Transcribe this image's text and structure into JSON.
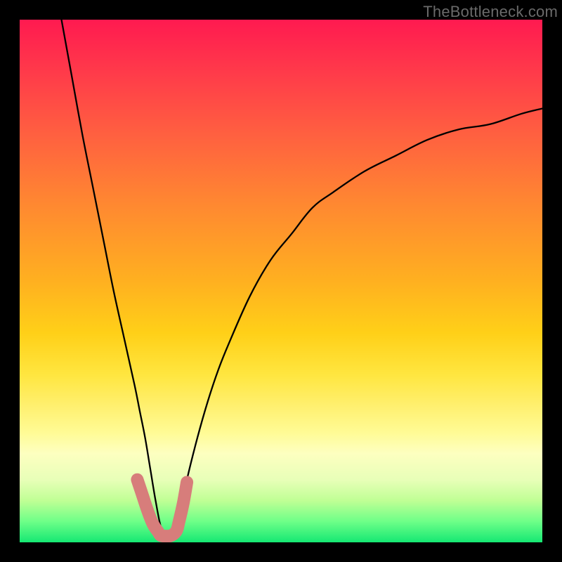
{
  "watermark": "TheBottleneck.com",
  "chart_data": {
    "type": "line",
    "title": "",
    "xlabel": "",
    "ylabel": "",
    "xlim": [
      0,
      100
    ],
    "ylim": [
      0,
      100
    ],
    "grid": false,
    "legend": null,
    "series": [
      {
        "name": "bottleneck-curve",
        "x": [
          8,
          10,
          12,
          14,
          16,
          18,
          20,
          22,
          23,
          24,
          25,
          26,
          27,
          28,
          29,
          30,
          31,
          32,
          34,
          36,
          38,
          40,
          44,
          48,
          52,
          56,
          60,
          66,
          72,
          78,
          84,
          90,
          96,
          100
        ],
        "y": [
          100,
          89,
          78,
          68,
          58,
          48,
          39,
          30,
          25,
          20,
          14,
          8,
          3,
          1,
          1,
          3,
          7,
          12,
          20,
          27,
          33,
          38,
          47,
          54,
          59,
          64,
          67,
          71,
          74,
          77,
          79,
          80,
          82,
          83
        ]
      }
    ],
    "highlight": {
      "name": "optimal-zone",
      "color": "#d77d7b",
      "x": [
        22.5,
        23.5,
        24.5,
        25.5,
        26.5,
        27.0,
        28.0,
        29.0,
        30.0,
        30.5,
        31.3,
        32.0
      ],
      "y": [
        12.0,
        9.0,
        6.0,
        3.5,
        2.0,
        1.3,
        1.2,
        1.3,
        2.2,
        4.0,
        7.5,
        11.5
      ]
    },
    "background_gradient": {
      "orientation": "vertical",
      "stops": [
        {
          "pos": 0.0,
          "color": "#ff1a50"
        },
        {
          "pos": 0.5,
          "color": "#ffb020"
        },
        {
          "pos": 0.8,
          "color": "#fffb95"
        },
        {
          "pos": 1.0,
          "color": "#15e873"
        }
      ]
    }
  }
}
